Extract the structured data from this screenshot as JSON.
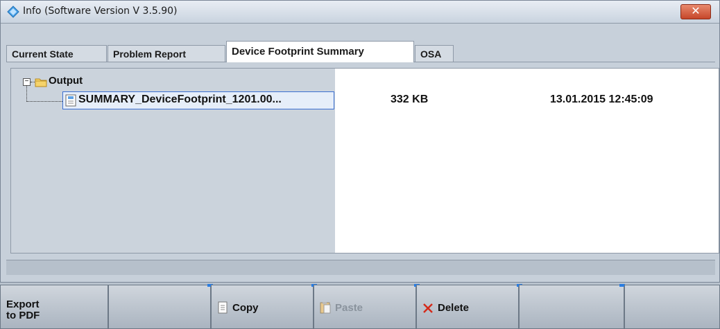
{
  "window": {
    "title": "Info (Software Version V 3.5.90)",
    "close_label": "✕"
  },
  "tabs": [
    {
      "label": "Current State",
      "active": false
    },
    {
      "label": "Problem Report",
      "active": false
    },
    {
      "label": "Device Footprint Summary",
      "active": true
    },
    {
      "label": "OSA",
      "active": false
    }
  ],
  "tree": {
    "folder": {
      "label": "Output",
      "expander": "−",
      "icon": "folder-icon"
    },
    "file": {
      "name": "SUMMARY_DeviceFootprint_1201.00...",
      "size": "332 KB",
      "date": "13.01.2015 12:45:09",
      "icon": "document-icon"
    }
  },
  "softkeys": [
    {
      "label_line1": "Export",
      "label_line2": "to PDF",
      "enabled": true
    },
    {
      "label": "",
      "enabled": true
    },
    {
      "label": "Copy",
      "icon": "copy-icon",
      "enabled": true
    },
    {
      "label": "Paste",
      "icon": "paste-icon",
      "enabled": false
    },
    {
      "label": "Delete",
      "icon": "delete-icon",
      "enabled": true
    },
    {
      "label": "",
      "enabled": true
    },
    {
      "label": "",
      "enabled": true
    }
  ],
  "colors": {
    "accent": "#3b6fd1",
    "close_button": "#c6462a",
    "delete_icon": "#d42a1a"
  }
}
